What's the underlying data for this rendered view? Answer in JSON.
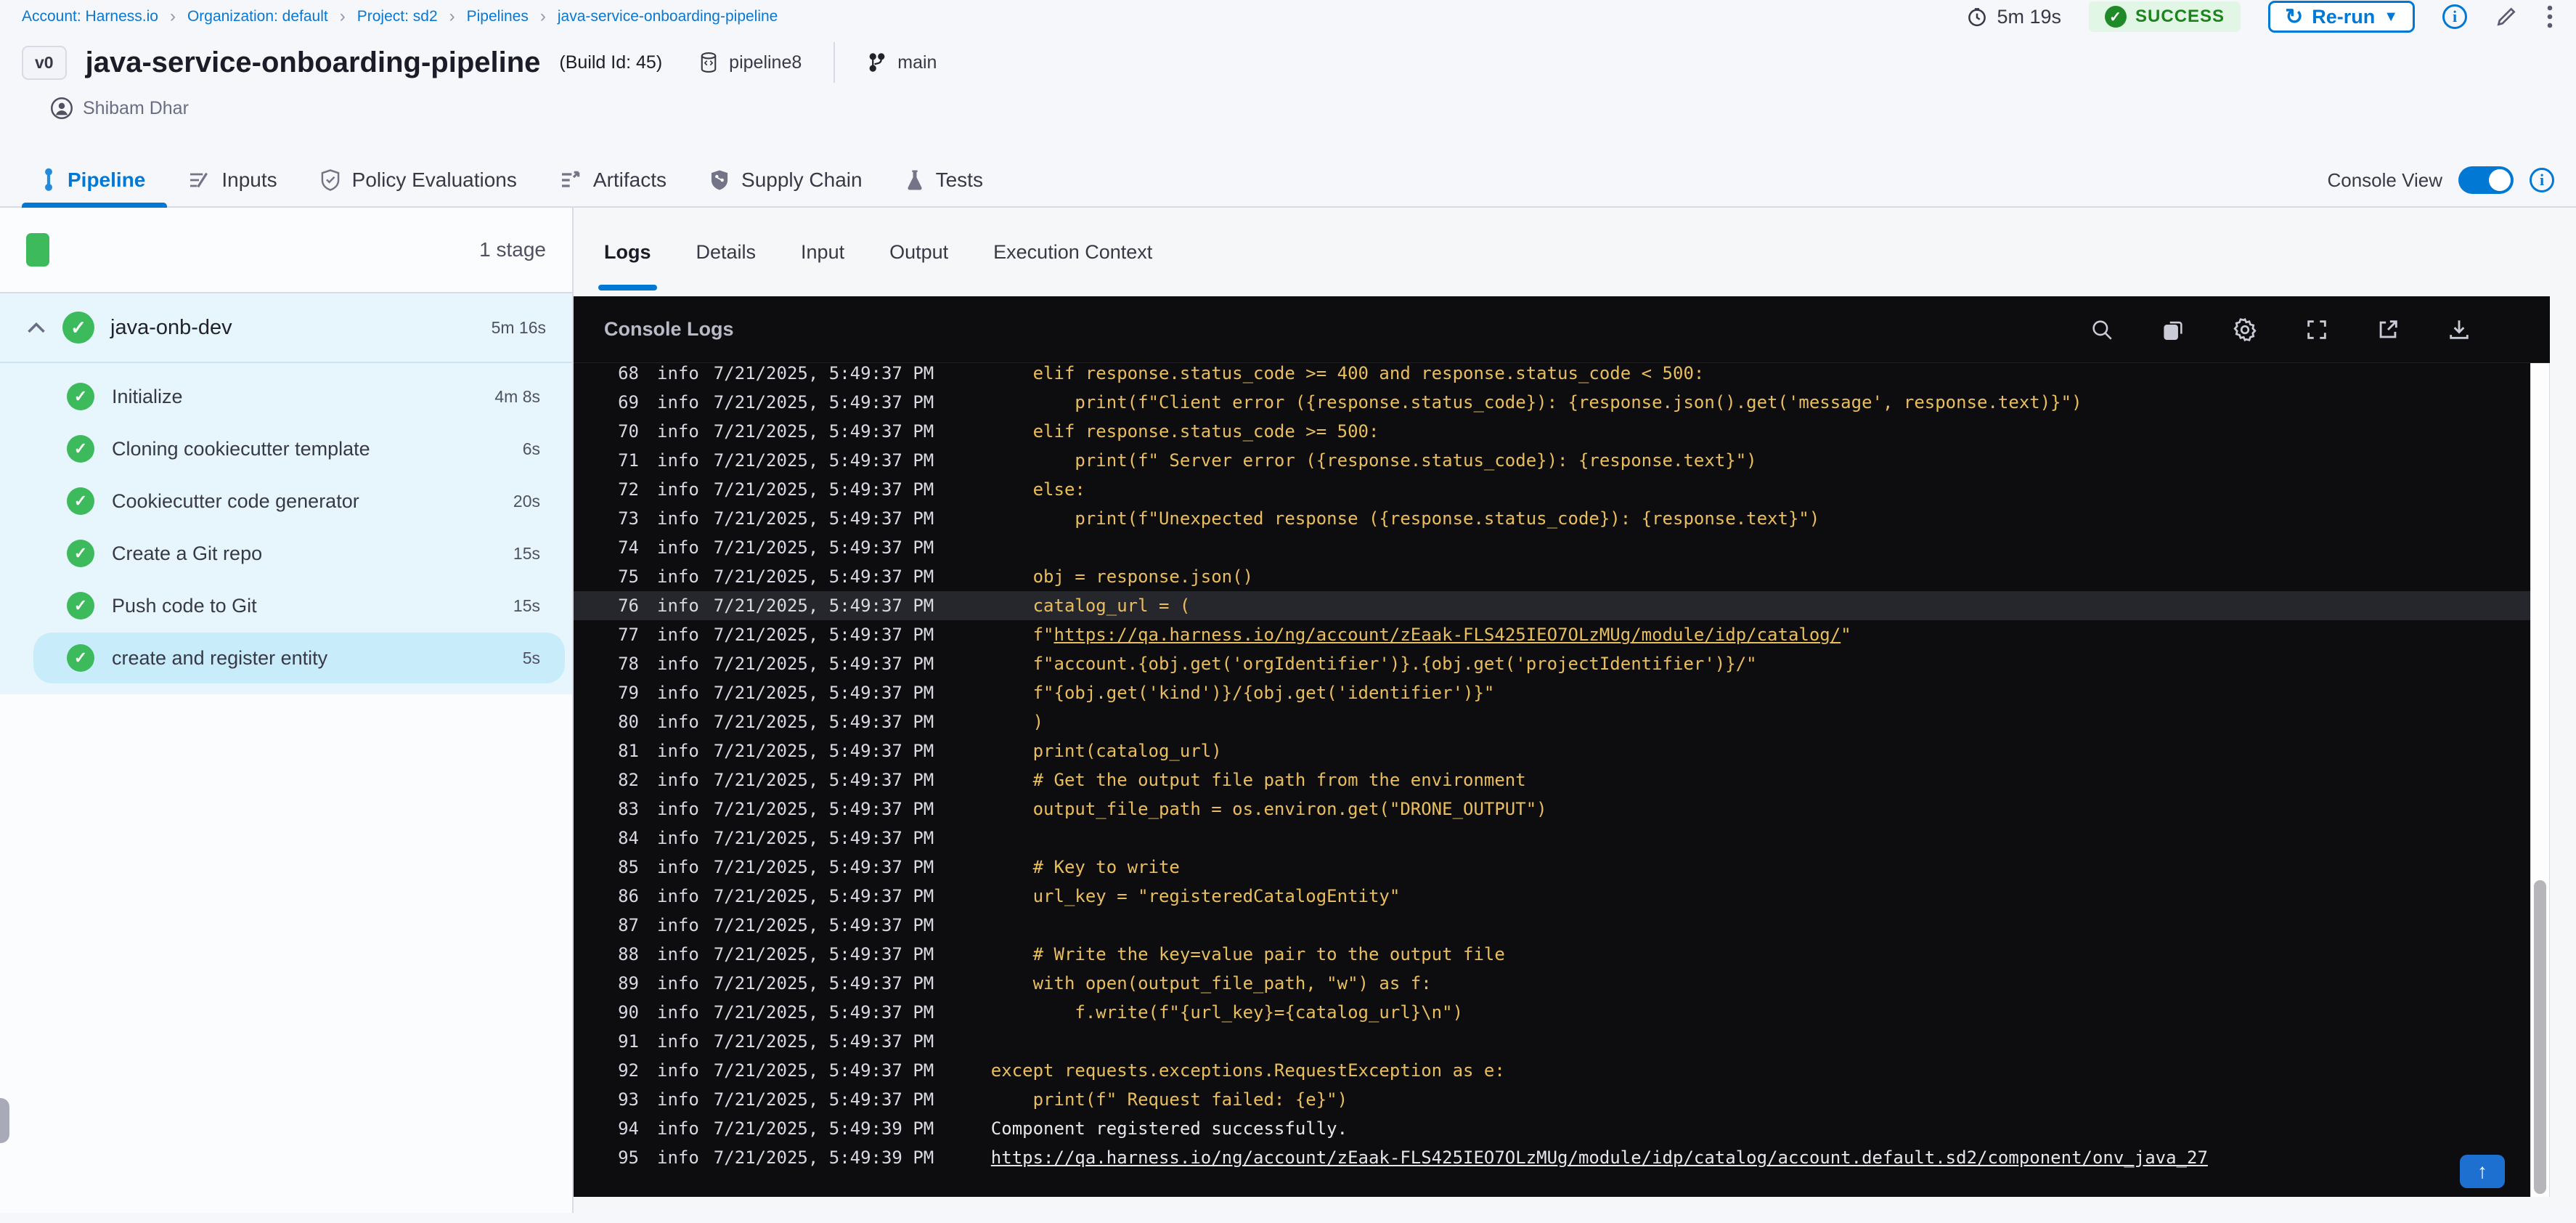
{
  "colors": {
    "accent": "#0278d5",
    "success_green": "#3dba5c",
    "log_yellow": "#e9be5e",
    "console_bg": "#0d0d0f"
  },
  "breadcrumb": {
    "items": [
      {
        "label": "Account: Harness.io"
      },
      {
        "label": "Organization: default"
      },
      {
        "label": "Project: sd2"
      },
      {
        "label": "Pipelines"
      },
      {
        "label": "java-service-onboarding-pipeline"
      }
    ]
  },
  "topbar": {
    "duration": "5m 19s",
    "status": "SUCCESS",
    "rerun_label": "Re-run"
  },
  "header": {
    "version_badge": "v0",
    "title": "java-service-onboarding-pipeline",
    "build_id": "(Build Id: 45)",
    "pipeline_ref": "pipeline8",
    "branch": "main",
    "user": "Shibam Dhar"
  },
  "tabs": [
    {
      "label": "Pipeline",
      "active": true
    },
    {
      "label": "Inputs",
      "active": false
    },
    {
      "label": "Policy Evaluations",
      "active": false
    },
    {
      "label": "Artifacts",
      "active": false
    },
    {
      "label": "Supply Chain",
      "active": false
    },
    {
      "label": "Tests",
      "active": false
    }
  ],
  "console_view": {
    "label": "Console View",
    "enabled": true
  },
  "sidebar": {
    "stage_count": "1 stage",
    "stage": {
      "name": "java-onb-dev",
      "duration": "5m 16s"
    },
    "steps": [
      {
        "name": "Initialize",
        "duration": "4m 8s"
      },
      {
        "name": "Cloning cookiecutter template",
        "duration": "6s"
      },
      {
        "name": "Cookiecutter code generator",
        "duration": "20s"
      },
      {
        "name": "Create a Git repo",
        "duration": "15s"
      },
      {
        "name": "Push code to Git",
        "duration": "15s"
      },
      {
        "name": "create and register entity",
        "duration": "5s",
        "selected": true
      }
    ]
  },
  "log_panel": {
    "tabs": [
      "Logs",
      "Details",
      "Input",
      "Output",
      "Execution Context"
    ],
    "active_tab": "Logs",
    "title": "Console Logs",
    "toolbar_icons": [
      "search",
      "copy",
      "settings",
      "fullscreen",
      "open-in-new",
      "download"
    ]
  },
  "logs": {
    "rows": [
      {
        "n": 68,
        "lvl": "info",
        "t": "7/21/2025, 5:49:37 PM",
        "msg": "    elif response.status_code >= 400 and response.status_code < 500:",
        "c": "y"
      },
      {
        "n": 69,
        "lvl": "info",
        "t": "7/21/2025, 5:49:37 PM",
        "msg": "        print(f\"Client error ({response.status_code}): {response.json().get('message', response.text)}\")",
        "c": "y"
      },
      {
        "n": 70,
        "lvl": "info",
        "t": "7/21/2025, 5:49:37 PM",
        "msg": "    elif response.status_code >= 500:",
        "c": "y"
      },
      {
        "n": 71,
        "lvl": "info",
        "t": "7/21/2025, 5:49:37 PM",
        "msg": "        print(f\" Server error ({response.status_code}): {response.text}\")",
        "c": "y"
      },
      {
        "n": 72,
        "lvl": "info",
        "t": "7/21/2025, 5:49:37 PM",
        "msg": "    else:",
        "c": "y"
      },
      {
        "n": 73,
        "lvl": "info",
        "t": "7/21/2025, 5:49:37 PM",
        "msg": "        print(f\"Unexpected response ({response.status_code}): {response.text}\")",
        "c": "y"
      },
      {
        "n": 74,
        "lvl": "info",
        "t": "7/21/2025, 5:49:37 PM",
        "msg": "",
        "c": "y"
      },
      {
        "n": 75,
        "lvl": "info",
        "t": "7/21/2025, 5:49:37 PM",
        "msg": "    obj = response.json()",
        "c": "y"
      },
      {
        "n": 76,
        "lvl": "info",
        "t": "7/21/2025, 5:49:37 PM",
        "msg": "    catalog_url = (",
        "c": "y",
        "hl": true
      },
      {
        "n": 77,
        "lvl": "info",
        "t": "7/21/2025, 5:49:37 PM",
        "pre": "    f\"",
        "link": "https://qa.harness.io/ng/account/zEaak-FLS425IEO7OLzMUg/module/idp/catalog/",
        "post": "\"",
        "c": "y"
      },
      {
        "n": 78,
        "lvl": "info",
        "t": "7/21/2025, 5:49:37 PM",
        "msg": "    f\"account.{obj.get('orgIdentifier')}.{obj.get('projectIdentifier')}/\"",
        "c": "y"
      },
      {
        "n": 79,
        "lvl": "info",
        "t": "7/21/2025, 5:49:37 PM",
        "msg": "    f\"{obj.get('kind')}/{obj.get('identifier')}\"",
        "c": "y"
      },
      {
        "n": 80,
        "lvl": "info",
        "t": "7/21/2025, 5:49:37 PM",
        "msg": "    )",
        "c": "y"
      },
      {
        "n": 81,
        "lvl": "info",
        "t": "7/21/2025, 5:49:37 PM",
        "msg": "    print(catalog_url)",
        "c": "y"
      },
      {
        "n": 82,
        "lvl": "info",
        "t": "7/21/2025, 5:49:37 PM",
        "msg": "    # Get the output file path from the environment",
        "c": "y"
      },
      {
        "n": 83,
        "lvl": "info",
        "t": "7/21/2025, 5:49:37 PM",
        "msg": "    output_file_path = os.environ.get(\"DRONE_OUTPUT\")",
        "c": "y"
      },
      {
        "n": 84,
        "lvl": "info",
        "t": "7/21/2025, 5:49:37 PM",
        "msg": "",
        "c": "y"
      },
      {
        "n": 85,
        "lvl": "info",
        "t": "7/21/2025, 5:49:37 PM",
        "msg": "    # Key to write",
        "c": "y"
      },
      {
        "n": 86,
        "lvl": "info",
        "t": "7/21/2025, 5:49:37 PM",
        "msg": "    url_key = \"registeredCatalogEntity\"",
        "c": "y"
      },
      {
        "n": 87,
        "lvl": "info",
        "t": "7/21/2025, 5:49:37 PM",
        "msg": "",
        "c": "y"
      },
      {
        "n": 88,
        "lvl": "info",
        "t": "7/21/2025, 5:49:37 PM",
        "msg": "    # Write the key=value pair to the output file",
        "c": "y"
      },
      {
        "n": 89,
        "lvl": "info",
        "t": "7/21/2025, 5:49:37 PM",
        "msg": "    with open(output_file_path, \"w\") as f:",
        "c": "y"
      },
      {
        "n": 90,
        "lvl": "info",
        "t": "7/21/2025, 5:49:37 PM",
        "msg": "        f.write(f\"{url_key}={catalog_url}\\n\")",
        "c": "y"
      },
      {
        "n": 91,
        "lvl": "info",
        "t": "7/21/2025, 5:49:37 PM",
        "msg": "",
        "c": "y"
      },
      {
        "n": 92,
        "lvl": "info",
        "t": "7/21/2025, 5:49:37 PM",
        "msg": "except requests.exceptions.RequestException as e:",
        "c": "y"
      },
      {
        "n": 93,
        "lvl": "info",
        "t": "7/21/2025, 5:49:37 PM",
        "msg": "    print(f\" Request failed: {e}\")",
        "c": "y"
      },
      {
        "n": 94,
        "lvl": "info",
        "t": "7/21/2025, 5:49:39 PM",
        "msg": "Component registered successfully.",
        "c": "w"
      },
      {
        "n": 95,
        "lvl": "info",
        "t": "7/21/2025, 5:49:39 PM",
        "link": "https://qa.harness.io/ng/account/zEaak-FLS425IEO7OLzMUg/module/idp/catalog/account.default.sd2/component/onv_java_27",
        "c": "w"
      }
    ]
  }
}
